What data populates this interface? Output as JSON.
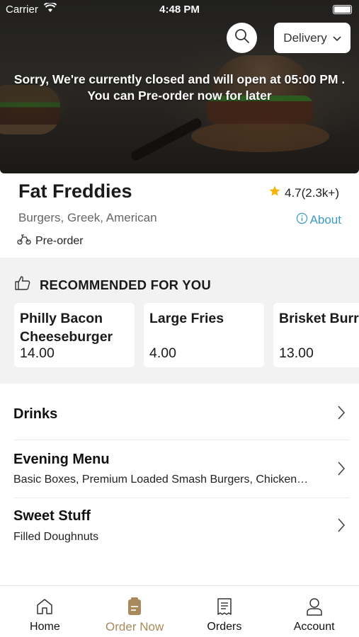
{
  "status_bar": {
    "carrier": "Carrier",
    "time": "4:48 PM"
  },
  "header": {
    "delivery_label": "Delivery",
    "closed_message_line1": "Sorry, We're currently closed and will open at 05:00 PM .",
    "closed_message_line2": "You can Pre-order now for later"
  },
  "restaurant": {
    "name": "Fat Freddies",
    "rating": "4.7(2.3k+)",
    "cuisines": "Burgers, Greek, American",
    "about_label": "About",
    "preorder_label": "Pre-order"
  },
  "recommended": {
    "title": "RECOMMENDED FOR YOU",
    "items": [
      {
        "name_line1": "Philly Bacon",
        "name_line2": "Cheeseburger",
        "price": "14.00"
      },
      {
        "name_line1": "Large Fries",
        "name_line2": "",
        "price": "4.00"
      },
      {
        "name_line1": "Brisket Burr",
        "name_line2": "",
        "price": "13.00"
      }
    ]
  },
  "categories": [
    {
      "title": "Drinks",
      "description": ""
    },
    {
      "title": "Evening Menu",
      "description": "Basic Boxes, Premium Loaded Smash Burgers, Chicken…"
    },
    {
      "title": "Sweet Stuff",
      "description": "Filled Doughnuts"
    }
  ],
  "bottom_nav": {
    "items": [
      {
        "label": "Home",
        "icon": "home-icon"
      },
      {
        "label": "Order Now",
        "icon": "order-bag-icon",
        "active": true
      },
      {
        "label": "Orders",
        "icon": "receipt-icon"
      },
      {
        "label": "Account",
        "icon": "user-icon"
      }
    ]
  },
  "colors": {
    "accent": "#a88a5c",
    "link": "#3a9bc4",
    "star": "#f5b50a",
    "section_bg": "#f2f2f2"
  }
}
